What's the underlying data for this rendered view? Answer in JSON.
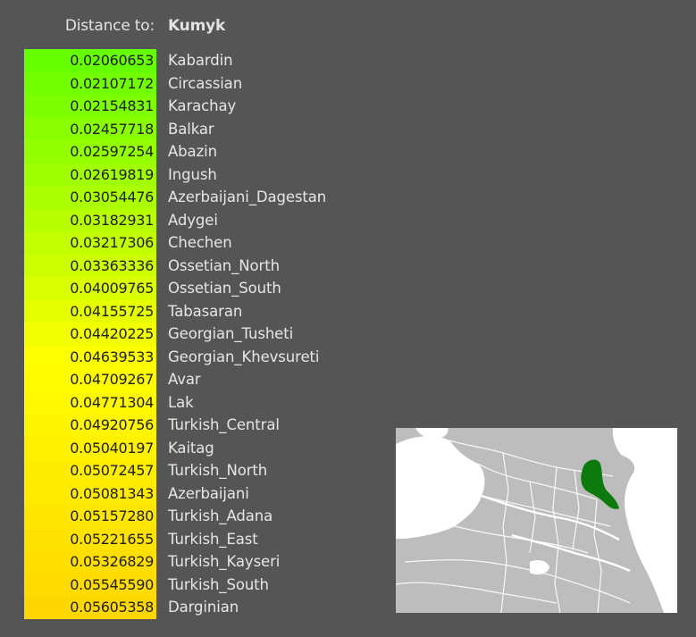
{
  "header": {
    "label": "Distance to:",
    "target": "Kumyk"
  },
  "colors": {
    "background": "#555555",
    "gradient_start": "#66ff00",
    "gradient_mid": "#ffff00",
    "gradient_end": "#ffd700",
    "highlight": "#0d7a0d",
    "land": "#bdbdbd",
    "water": "#ffffff"
  },
  "chart_data": {
    "type": "table",
    "title": "Distance to: Kumyk",
    "rows": [
      {
        "distance": "0.02060653",
        "population": "Kabardin"
      },
      {
        "distance": "0.02107172",
        "population": "Circassian"
      },
      {
        "distance": "0.02154831",
        "population": "Karachay"
      },
      {
        "distance": "0.02457718",
        "population": "Balkar"
      },
      {
        "distance": "0.02597254",
        "population": "Abazin"
      },
      {
        "distance": "0.02619819",
        "population": "Ingush"
      },
      {
        "distance": "0.03054476",
        "population": "Azerbaijani_Dagestan"
      },
      {
        "distance": "0.03182931",
        "population": "Adygei"
      },
      {
        "distance": "0.03217306",
        "population": "Chechen"
      },
      {
        "distance": "0.03363336",
        "population": "Ossetian_North"
      },
      {
        "distance": "0.04009765",
        "population": "Ossetian_South"
      },
      {
        "distance": "0.04155725",
        "population": "Tabasaran"
      },
      {
        "distance": "0.04420225",
        "population": "Georgian_Tusheti"
      },
      {
        "distance": "0.04639533",
        "population": "Georgian_Khevsureti"
      },
      {
        "distance": "0.04709267",
        "population": "Avar"
      },
      {
        "distance": "0.04771304",
        "population": "Lak"
      },
      {
        "distance": "0.04920756",
        "population": "Turkish_Central"
      },
      {
        "distance": "0.05040197",
        "population": "Kaitag"
      },
      {
        "distance": "0.05072457",
        "population": "Turkish_North"
      },
      {
        "distance": "0.05081343",
        "population": "Azerbaijani"
      },
      {
        "distance": "0.05157280",
        "population": "Turkish_Adana"
      },
      {
        "distance": "0.05221655",
        "population": "Turkish_East"
      },
      {
        "distance": "0.05326829",
        "population": "Turkish_Kayseri"
      },
      {
        "distance": "0.05545590",
        "population": "Turkish_South"
      },
      {
        "distance": "0.05605358",
        "population": "Darginian"
      }
    ]
  },
  "map": {
    "icon": "region-map"
  }
}
